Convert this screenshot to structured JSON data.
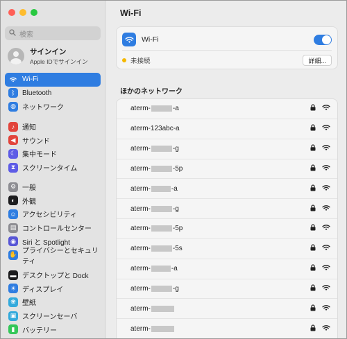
{
  "window": {
    "traffic_lights": {
      "close": "#ff5f57",
      "minimize": "#febc2e",
      "zoom": "#28c840"
    }
  },
  "sidebar": {
    "search_placeholder": "検索",
    "account": {
      "name": "サインイン",
      "sub": "Apple IDでサインイン"
    },
    "groups": [
      [
        {
          "label": "Wi-Fi",
          "icon": "wifi-icon",
          "color": "#2f7de1",
          "active": true
        },
        {
          "label": "Bluetooth",
          "icon": "bluetooth-icon",
          "color": "#2f7de1"
        },
        {
          "label": "ネットワーク",
          "icon": "globe-icon",
          "color": "#2f7de1"
        }
      ],
      [
        {
          "label": "通知",
          "icon": "bell-icon",
          "color": "#e2453c"
        },
        {
          "label": "サウンド",
          "icon": "speaker-icon",
          "color": "#e2453c"
        },
        {
          "label": "集中モード",
          "icon": "moon-icon",
          "color": "#5e5ce6"
        },
        {
          "label": "スクリーンタイム",
          "icon": "hourglass-icon",
          "color": "#5e5ce6"
        }
      ],
      [
        {
          "label": "一般",
          "icon": "gear-icon",
          "color": "#8e8e93"
        },
        {
          "label": "外観",
          "icon": "appearance-icon",
          "color": "#1c1c1e"
        },
        {
          "label": "アクセシビリティ",
          "icon": "accessibility-icon",
          "color": "#2f7de1"
        },
        {
          "label": "コントロールセンター",
          "icon": "control-center-icon",
          "color": "#8e8e93"
        },
        {
          "label": "Siri と Spotlight",
          "icon": "siri-icon",
          "color": "#5856d6"
        },
        {
          "label": "プライバシーとセキュリティ",
          "icon": "hand-icon",
          "color": "#2f7de1"
        }
      ],
      [
        {
          "label": "デスクトップと Dock",
          "icon": "dock-icon",
          "color": "#1c1c1e"
        },
        {
          "label": "ディスプレイ",
          "icon": "display-icon",
          "color": "#2f7de1"
        },
        {
          "label": "壁紙",
          "icon": "wallpaper-icon",
          "color": "#34aadc"
        },
        {
          "label": "スクリーンセーバ",
          "icon": "screensaver-icon",
          "color": "#34aadc"
        },
        {
          "label": "バッテリー",
          "icon": "battery-icon",
          "color": "#34c759"
        }
      ]
    ]
  },
  "main": {
    "title": "Wi-Fi",
    "wifi_label": "Wi-Fi",
    "wifi_enabled": true,
    "status_text": "未接続",
    "details_button": "詳細...",
    "other_networks_heading": "ほかのネットワーク",
    "networks": [
      {
        "prefix": "aterm-",
        "suffix": "-a",
        "redacted": true,
        "locked": true
      },
      {
        "prefix": "aterm-123abc-a",
        "suffix": "",
        "redacted": false,
        "locked": true
      },
      {
        "prefix": "aterm-",
        "suffix": "-g",
        "redacted": true,
        "locked": true
      },
      {
        "prefix": "aterm-",
        "suffix": "-5p",
        "redacted": true,
        "locked": true
      },
      {
        "prefix": "aterm-",
        "suffix": "-a",
        "redacted": true,
        "locked": true
      },
      {
        "prefix": "aterm-",
        "suffix": "-g",
        "redacted": true,
        "locked": true
      },
      {
        "prefix": "aterm-",
        "suffix": "-5p",
        "redacted": true,
        "locked": true
      },
      {
        "prefix": "aterm-",
        "suffix": "-5s",
        "redacted": true,
        "locked": true
      },
      {
        "prefix": "aterm-",
        "suffix": "-a",
        "redacted": true,
        "locked": true
      },
      {
        "prefix": "aterm-",
        "suffix": "-g",
        "redacted": true,
        "locked": true
      },
      {
        "prefix": "aterm-",
        "suffix": "",
        "redacted": true,
        "locked": true
      },
      {
        "prefix": "aterm-",
        "suffix": "",
        "redacted": true,
        "locked": true
      }
    ]
  }
}
